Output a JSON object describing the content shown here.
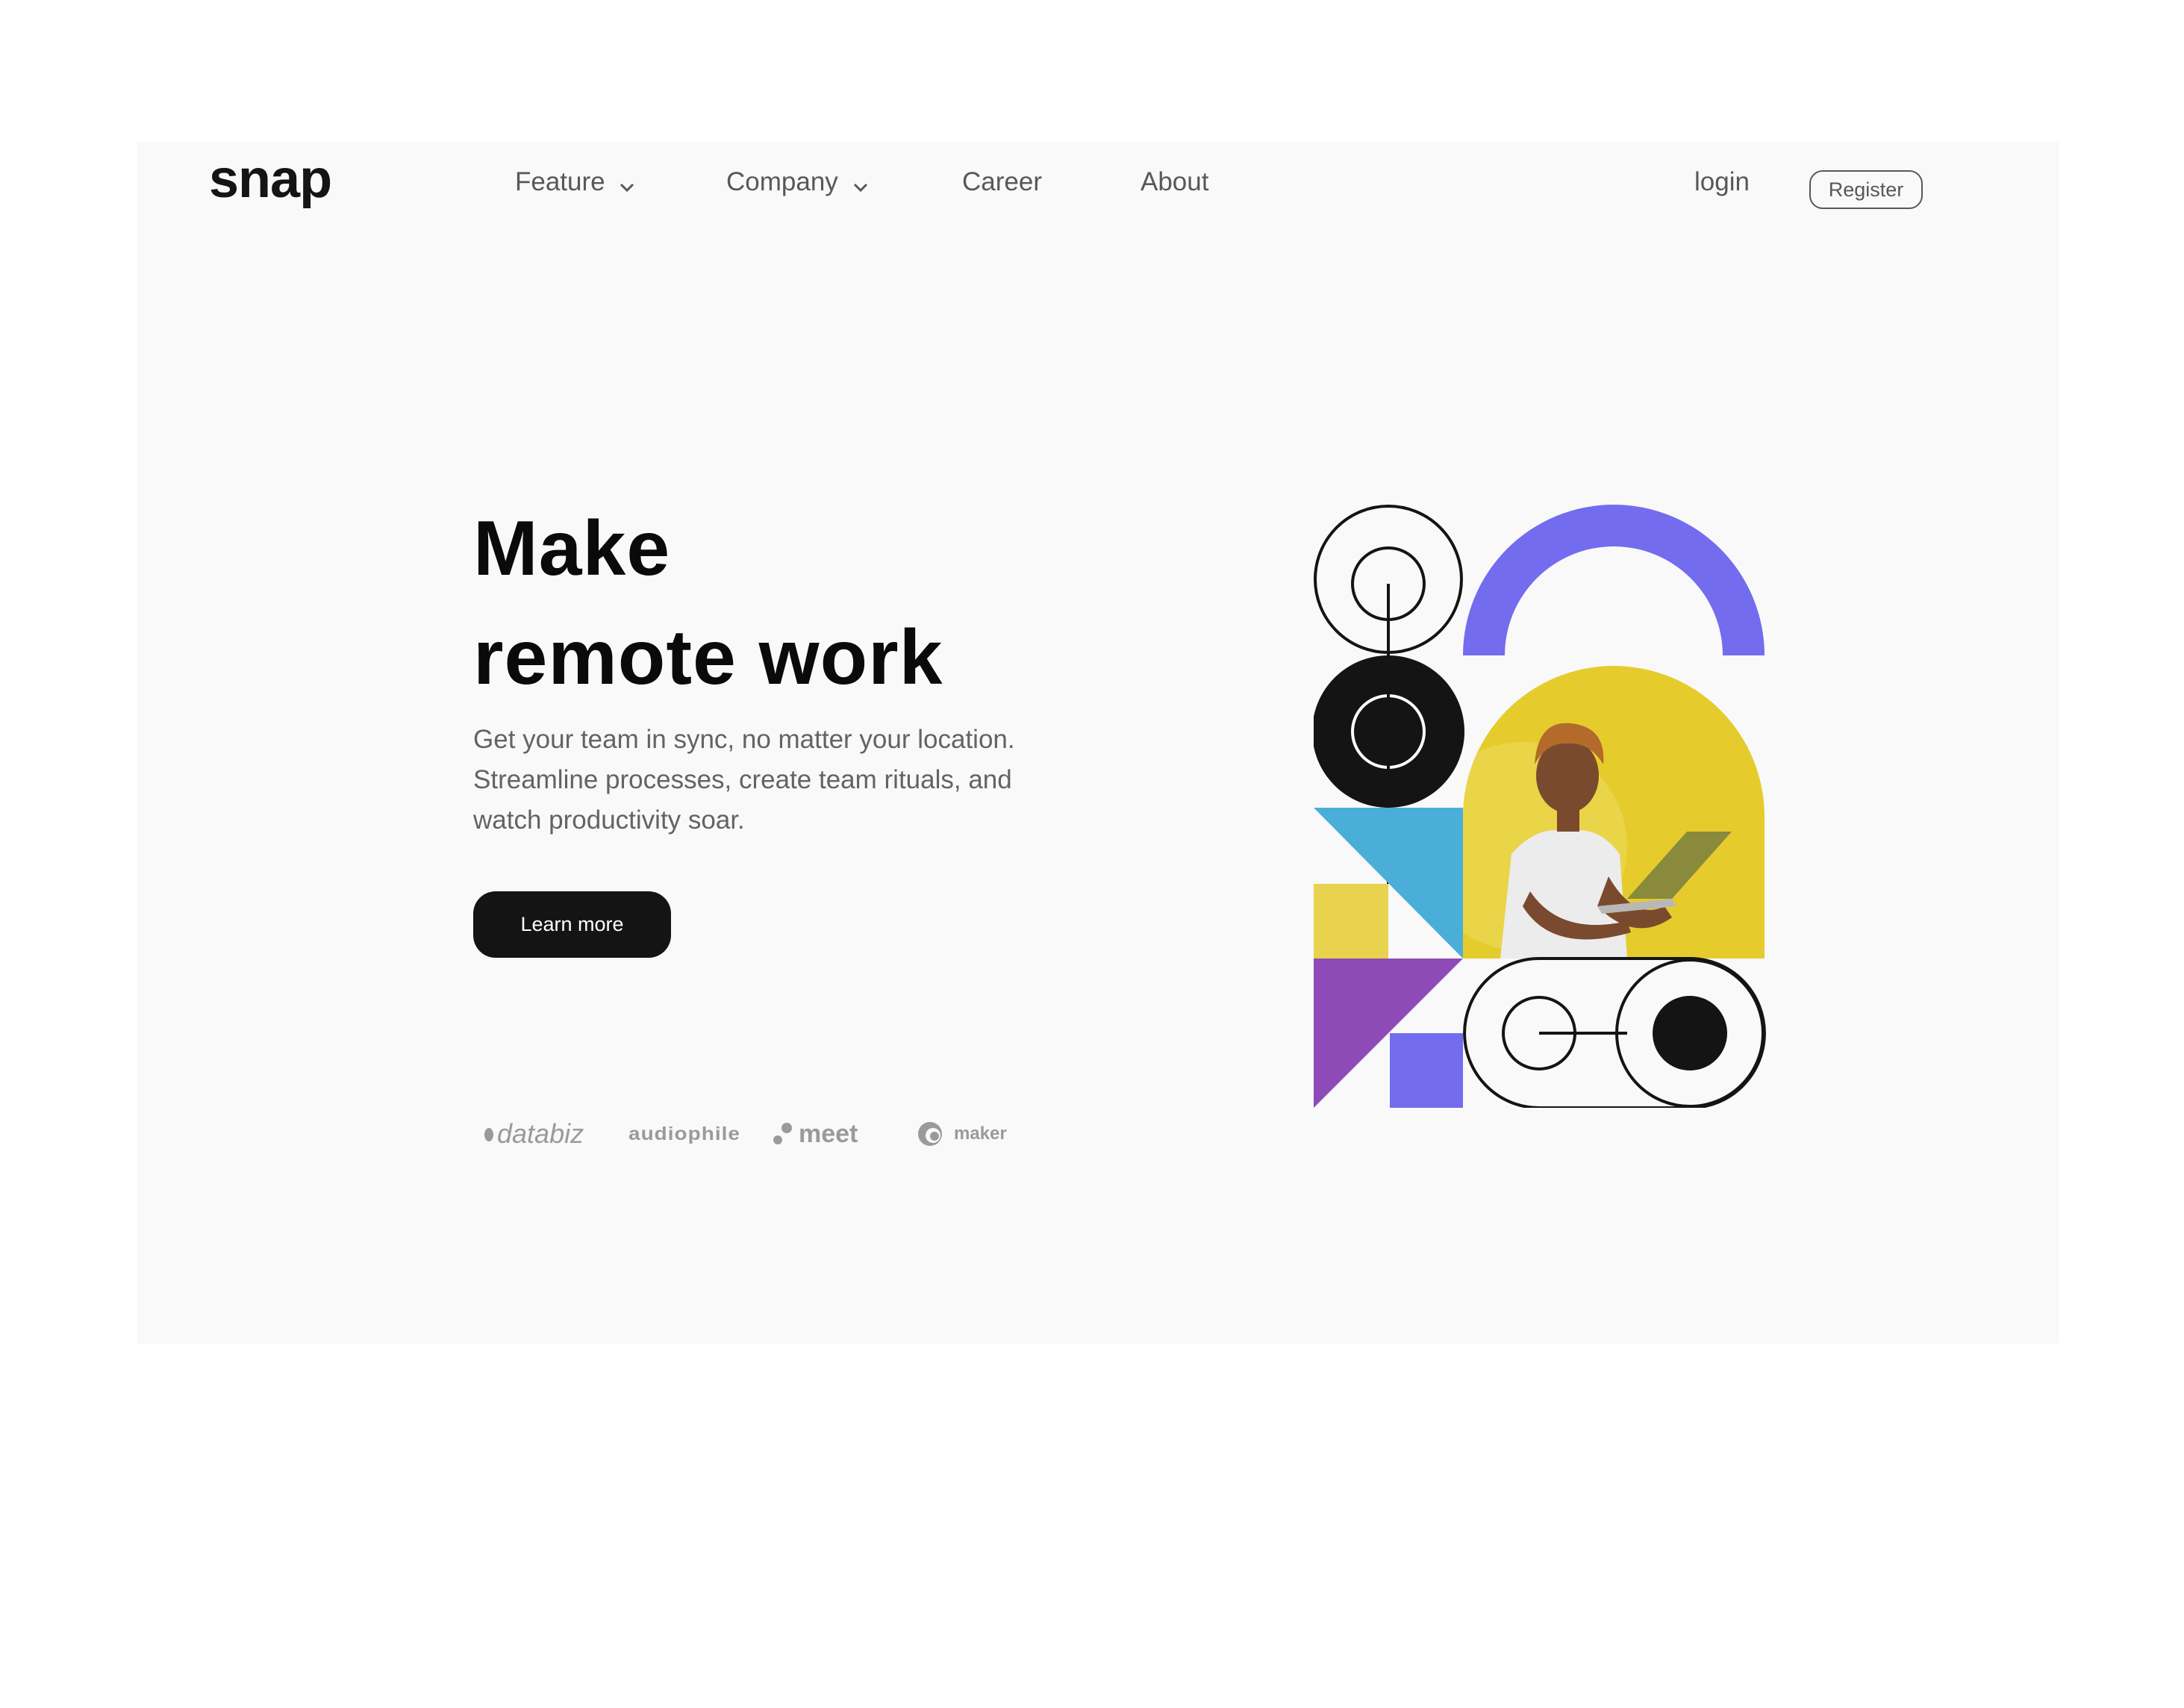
{
  "brand": {
    "logo_text": "snap"
  },
  "nav": {
    "items": [
      {
        "label": "Feature",
        "has_dropdown": true,
        "icon": "chevron-down-icon"
      },
      {
        "label": "Company",
        "has_dropdown": true,
        "icon": "chevron-down-icon"
      },
      {
        "label": "Career",
        "has_dropdown": false
      },
      {
        "label": "About",
        "has_dropdown": false
      }
    ],
    "login_label": "login",
    "register_label": "Register"
  },
  "hero": {
    "headline_line1": "Make",
    "headline_line2": "remote work",
    "description": "Get your team in sync, no matter your location. Streamline processes, create team rituals, and watch productivity soar.",
    "cta_label": "Learn more",
    "illustration_alt": "Person holding a laptop"
  },
  "clients": {
    "logos": [
      {
        "name": "databiz",
        "icon": "dot-icon"
      },
      {
        "name": "audiophile",
        "icon": "none"
      },
      {
        "name": "meet",
        "icon": "two-dots-icon"
      },
      {
        "name": "maker",
        "icon": "swirl-icon"
      }
    ]
  },
  "colors": {
    "page_bg": "#ffffff",
    "card_bg": "#f9f9f9",
    "text_dark": "#0a0a0a",
    "text_muted": "#636363",
    "button_bg": "#141414",
    "purple": "#736cee",
    "yellow": "#e9d24d",
    "blue": "#4aaed9",
    "violet": "#8e4ab6",
    "photo_bg": "#e5cc2c"
  }
}
